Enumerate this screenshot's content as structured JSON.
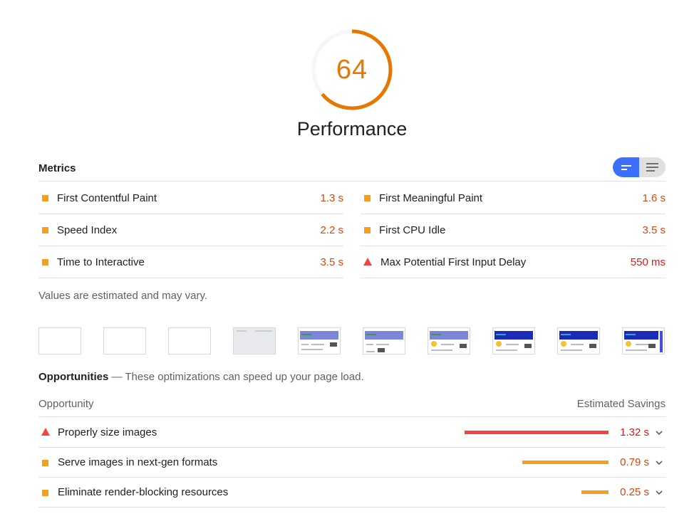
{
  "gauge": {
    "score": "64",
    "fraction": 0.64,
    "color": "#e67700"
  },
  "category": {
    "title": "Performance"
  },
  "metrics": {
    "title": "Metrics",
    "left": [
      {
        "label": "First Contentful Paint",
        "value": "1.3 s",
        "icon": "average-square-icon"
      },
      {
        "label": "Speed Index",
        "value": "2.2 s",
        "icon": "average-square-icon"
      },
      {
        "label": "Time to Interactive",
        "value": "3.5 s",
        "icon": "average-square-icon"
      }
    ],
    "right": [
      {
        "label": "First Meaningful Paint",
        "value": "1.6 s",
        "icon": "average-square-icon"
      },
      {
        "label": "First CPU Idle",
        "value": "3.5 s",
        "icon": "average-square-icon"
      },
      {
        "label": "Max Potential First Input Delay",
        "value": "550 ms",
        "icon": "fail-triangle-icon"
      }
    ],
    "note": "Values are estimated and may vary."
  },
  "filmstrip": {
    "frame_count": 10
  },
  "opportunities": {
    "heading": "Opportunities",
    "description": " — These optimizations can speed up your page load.",
    "col_opportunity": "Opportunity",
    "col_savings": "Estimated Savings",
    "items": [
      {
        "label": "Properly size images",
        "value": "1.32 s",
        "savings_s": 1.32,
        "icon": "fail-triangle-icon",
        "color": "#f24444",
        "value_color": "#d71a1a"
      },
      {
        "label": "Serve images in next-gen formats",
        "value": "0.79 s",
        "savings_s": 0.79,
        "icon": "average-square-icon",
        "color": "#f59f1a",
        "value_color": "#d6480c"
      },
      {
        "label": "Eliminate render-blocking resources",
        "value": "0.25 s",
        "savings_s": 0.25,
        "icon": "average-square-icon",
        "color": "#f59f1a",
        "value_color": "#d6480c"
      }
    ]
  }
}
